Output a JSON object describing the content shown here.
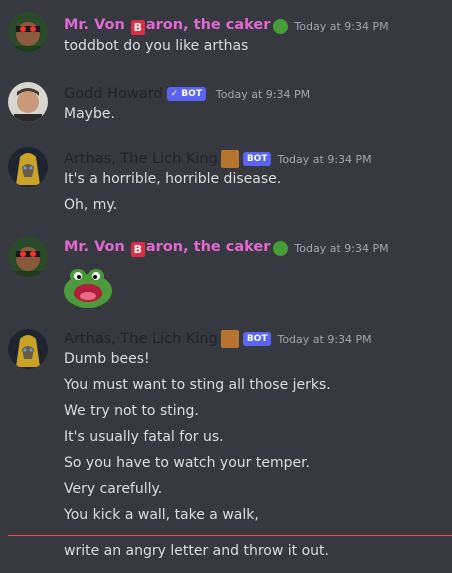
{
  "messages": [
    {
      "username_prefix": "Mr. Von",
      "username_b": "B",
      "username_suffix": "aron, the caker",
      "timestamp": "Today at 9:34 PM",
      "lines": [
        "toddbot do you like arthas"
      ]
    },
    {
      "username": "Godd Howard",
      "badge": "✓ BOT",
      "timestamp": "Today at 9:34 PM",
      "lines": [
        "Maybe."
      ]
    },
    {
      "username": "Arthas, The Lich King",
      "badge": "BOT",
      "timestamp": "Today at 9:34 PM",
      "lines": [
        "It's a horrible, horrible disease.",
        "Oh, my."
      ]
    },
    {
      "username_prefix": "Mr. Von",
      "username_b": "B",
      "username_suffix": "aron, the caker",
      "timestamp": "Today at 9:34 PM",
      "sticker": "pepe-emoji"
    },
    {
      "username": "Arthas, The Lich King",
      "badge": "BOT",
      "timestamp": "Today at 9:34 PM",
      "lines": [
        "Dumb bees!",
        "You must want to sting all those jerks.",
        "We try not to sting.",
        "It's usually fatal for us.",
        "So you have to watch your temper.",
        "Very carefully.",
        "You kick a wall, take a walk,"
      ]
    }
  ],
  "after_divider": "write an angry letter and throw it out.",
  "colors": {
    "background": "#36393f",
    "username_pink": "#e368d1",
    "badge": "#5865f2",
    "divider": "#f04747"
  }
}
